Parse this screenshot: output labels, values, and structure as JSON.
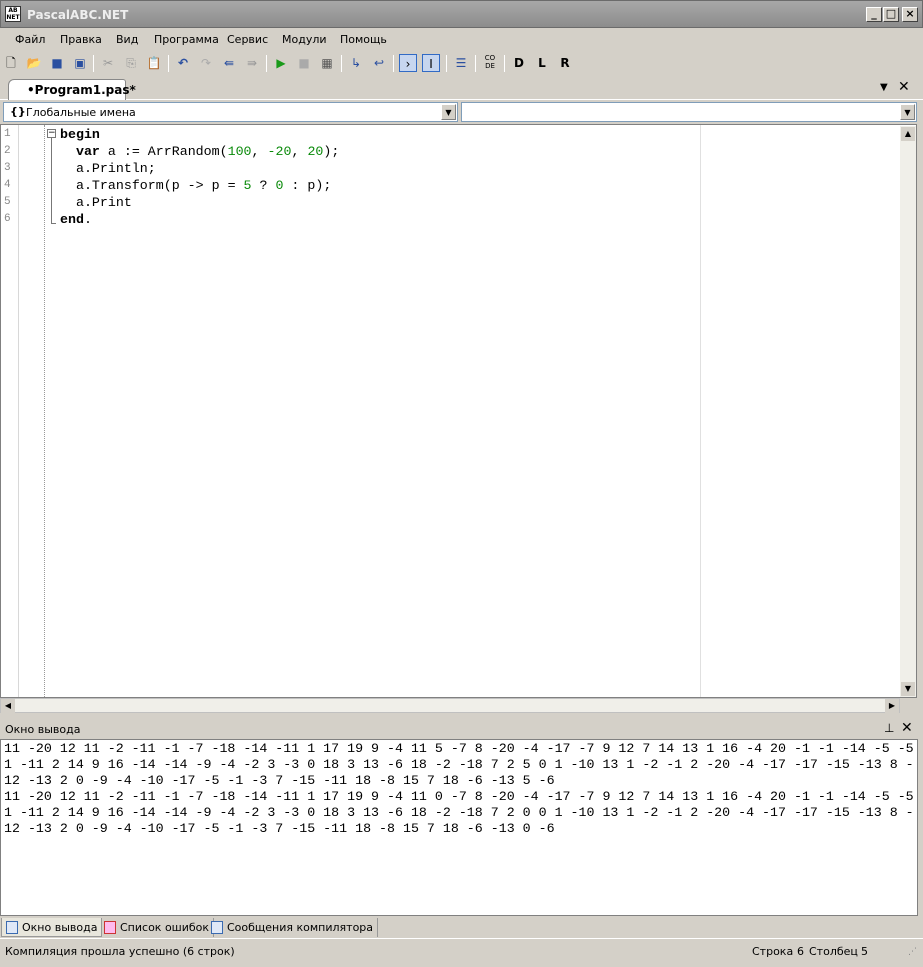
{
  "window": {
    "title": "PascalABC.NET",
    "icon_text": "AB NET"
  },
  "menu": [
    "Файл",
    "Правка",
    "Вид",
    "Программа",
    "Сервис",
    "Модули",
    "Помощь"
  ],
  "toolbar": [
    "new-file",
    "open",
    "save",
    "save-all",
    "cut",
    "copy",
    "paste",
    "undo",
    "redo",
    "compile",
    "compile-all",
    "run",
    "stop",
    "debug",
    "step-into",
    "step-over",
    "output-window",
    "form-designer",
    "properties",
    "code-template",
    "debug-d",
    "debug-l",
    "debug-r"
  ],
  "tab": {
    "label": "•Program1.pas*"
  },
  "combo": {
    "left": "Глобальные имена",
    "left_icon": "{}",
    "right": ""
  },
  "editor": {
    "line_numbers": [
      "1",
      "2",
      "3",
      "4",
      "5",
      "6"
    ],
    "lines": [
      [
        {
          "t": "begin",
          "c": "kw"
        }
      ],
      [
        {
          "t": "  "
        },
        {
          "t": "var",
          "c": "kw"
        },
        {
          "t": " a := ArrRandom("
        },
        {
          "t": "100",
          "c": "num"
        },
        {
          "t": ", "
        },
        {
          "t": "-20",
          "c": "num"
        },
        {
          "t": ", "
        },
        {
          "t": "20",
          "c": "num"
        },
        {
          "t": ");"
        }
      ],
      [
        {
          "t": "  a.Println;"
        }
      ],
      [
        {
          "t": "  a.Transform(p -> p = "
        },
        {
          "t": "5",
          "c": "num"
        },
        {
          "t": " ? "
        },
        {
          "t": "0",
          "c": "num"
        },
        {
          "t": " : p);"
        }
      ],
      [
        {
          "t": "  a.Print"
        }
      ],
      [
        {
          "t": "end",
          "c": "kw"
        },
        {
          "t": "."
        }
      ]
    ]
  },
  "output": {
    "title": "Окно вывода",
    "lines": [
      "11 -20 12 11 -2 -11 -1 -7 -18 -14 -11 1 17 19 9 -4 11 5 -7 8 -20 -4 -17 -7 9 12 7 14 13 1 16 -4 20 -1 -1 -14 -5 -5",
      "1 -11 2 14 9 16 -14 -14 -9 -4 -2 3 -3 0 18 3 13 -6 18 -2 -18 7 2 5 0 1 -10 13 1 -2 -1 2 -20 -4 -17 -17 -15 -13 8 -",
      "12 -13 2 0 -9 -4 -10 -17 -5 -1 -3 7 -15 -11 18 -8 15 7 18 -6 -13 5 -6",
      "11 -20 12 11 -2 -11 -1 -7 -18 -14 -11 1 17 19 9 -4 11 0 -7 8 -20 -4 -17 -7 9 12 7 14 13 1 16 -4 20 -1 -1 -14 -5 -5",
      "1 -11 2 14 9 16 -14 -14 -9 -4 -2 3 -3 0 18 3 13 -6 18 -2 -18 7 2 0 0 1 -10 13 1 -2 -1 2 -20 -4 -17 -17 -15 -13 8 -",
      "12 -13 2 0 -9 -4 -10 -17 -5 -1 -3 7 -15 -11 18 -8 15 7 18 -6 -13 0 -6"
    ]
  },
  "bottom_tabs": [
    "Окно вывода",
    "Список ошибок",
    "Сообщения компилятора"
  ],
  "status": {
    "message": "Компиляция прошла успешно (6 строк)",
    "row_label": "Строка",
    "row": "6",
    "col_label": "Столбец",
    "col": "5"
  }
}
